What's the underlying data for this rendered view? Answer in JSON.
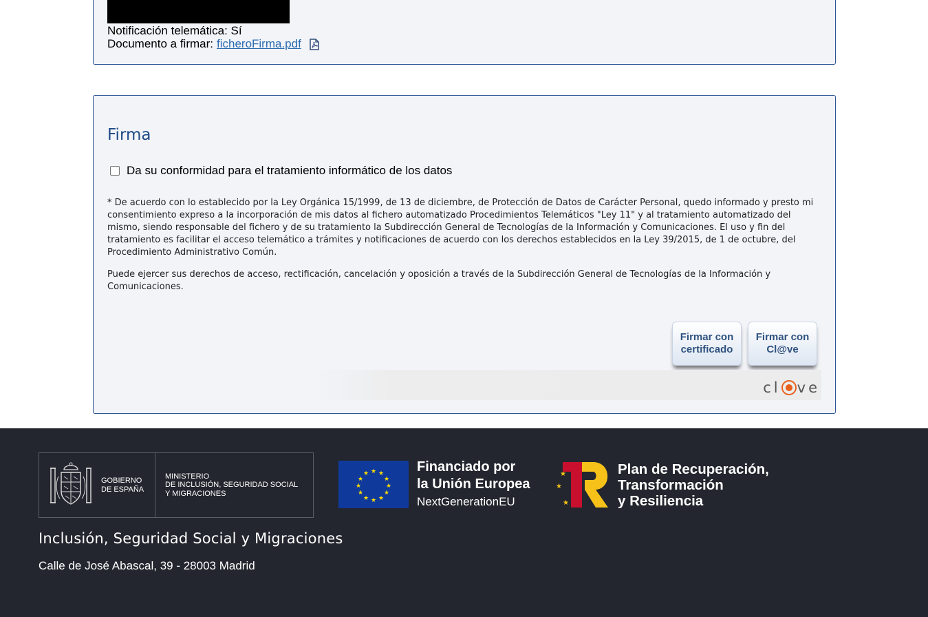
{
  "request_summary": {
    "notification_label": "Notificación telemática: Sí",
    "document_label": "Documento a firmar:",
    "document_link": "ficheroFirma.pdf"
  },
  "firma": {
    "title": "Firma",
    "consent_label": "Da su conformidad para el tratamiento informático de los datos",
    "consent_checked": false,
    "legal_paragraph_1": "* De acuerdo con lo establecido por la Ley Orgánica 15/1999, de 13 de diciembre, de Protección de Datos de Carácter Personal, quedo informado y presto mi consentimiento expreso a la incorporación de mis datos al fichero automatizado Procedimientos Telemáticos \"Ley 11\" y al tratamiento automatizado del mismo, siendo responsable del fichero y de su tratamiento la Subdirección General de Tecnologías de la Información y Comunicaciones. El uso y fin del tratamiento es facilitar el acceso telemático a trámites y notificaciones de acuerdo con los derechos establecidos en la Ley 39/2015, de 1 de octubre, del Procedimiento Administrativo Común.",
    "legal_paragraph_2": "Puede ejercer sus derechos de acceso, rectificación, cancelación y oposición a través de la Subdirección General de Tecnologías de la Información y Comunicaciones.",
    "btn_cert_line1": "Firmar con",
    "btn_cert_line2": "certificado",
    "btn_clave_line1": "Firmar con",
    "btn_clave_line2": "Cl@ve",
    "clave_logo_left": "cl",
    "clave_logo_right": "ve"
  },
  "footer": {
    "gov_line1": "GOBIERNO",
    "gov_line2": "DE ESPAÑA",
    "ministry_line1": "MINISTERIO",
    "ministry_line2": "DE INCLUSIÓN, SEGURIDAD SOCIAL",
    "ministry_line3": "Y MIGRACIONES",
    "eu_line1": "Financiado por",
    "eu_line2": "la Unión Europea",
    "eu_line3": "NextGenerationEU",
    "prtr_line1": "Plan de Recuperación,",
    "prtr_line2": "Transformación",
    "prtr_line3": "y Resiliencia",
    "ministry_name": "Inclusión, Seguridad Social y Migraciones",
    "address": "Calle de José Abascal, 39 - 28003 Madrid"
  },
  "colors": {
    "panel_border": "#2d5592",
    "title": "#1f4a86",
    "footer_bg": "#23262e",
    "eu_blue": "#0f3a9c",
    "prtr_red": "#c8102e",
    "prtr_yellow": "#f6c21a",
    "clave_orange": "#e8601c"
  },
  "icons": [
    "pdf-file-icon",
    "coat-of-arms-icon",
    "eu-flag-icon",
    "prtr-logo-icon",
    "clave-logo-icon"
  ]
}
